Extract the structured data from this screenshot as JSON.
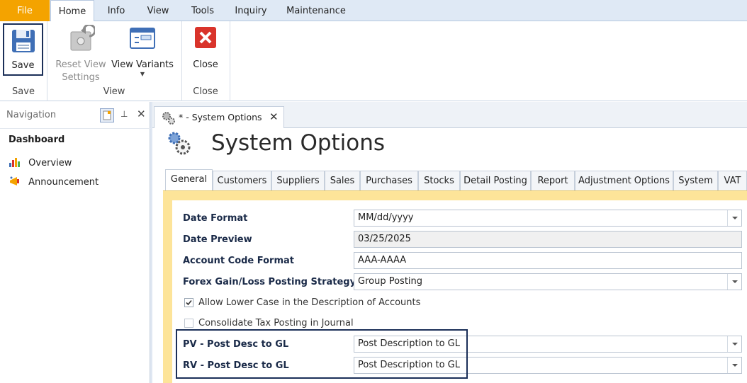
{
  "menu": {
    "tabs": [
      "File",
      "Home",
      "Info",
      "View",
      "Tools",
      "Inquiry",
      "Maintenance"
    ]
  },
  "ribbon": {
    "save": "Save",
    "reset_line1": "Reset View",
    "reset_line2": "Settings",
    "view_variants": "View Variants",
    "close": "Close",
    "groups": {
      "save": "Save",
      "view": "View",
      "close": "Close"
    }
  },
  "navigation": {
    "title": "Navigation",
    "section": "Dashboard",
    "items": [
      "Overview",
      "Announcement"
    ]
  },
  "document_tab": {
    "label": "* - System Options"
  },
  "page": {
    "title": "System Options"
  },
  "subtabs": [
    "General",
    "Customers",
    "Suppliers",
    "Sales",
    "Purchases",
    "Stocks",
    "Detail Posting",
    "Report",
    "Adjustment Options",
    "System",
    "VAT"
  ],
  "form": {
    "date_format": {
      "label": "Date Format",
      "value": "MM/dd/yyyy"
    },
    "date_preview": {
      "label": "Date Preview",
      "value": "03/25/2025"
    },
    "account_code_format": {
      "label": "Account Code Format",
      "value": "AAA-AAAA"
    },
    "forex_strategy": {
      "label": "Forex Gain/Loss Posting Strategy",
      "value": "Group Posting"
    },
    "allow_lower_case": {
      "label": "Allow Lower Case in the Description of Accounts",
      "checked": true
    },
    "consolidate_tax": {
      "label": "Consolidate Tax Posting in Journal",
      "checked": false
    },
    "pv_post_desc": {
      "label": "PV - Post Desc to GL",
      "value": "Post Description to GL"
    },
    "rv_post_desc": {
      "label": "RV - Post Desc to GL",
      "value": "Post Description to GL"
    }
  },
  "colors": {
    "file_tab": "#f4a300",
    "accent_border": "#1b2f58",
    "form_frame": "#fde499",
    "close_icon": "#d9342b"
  }
}
